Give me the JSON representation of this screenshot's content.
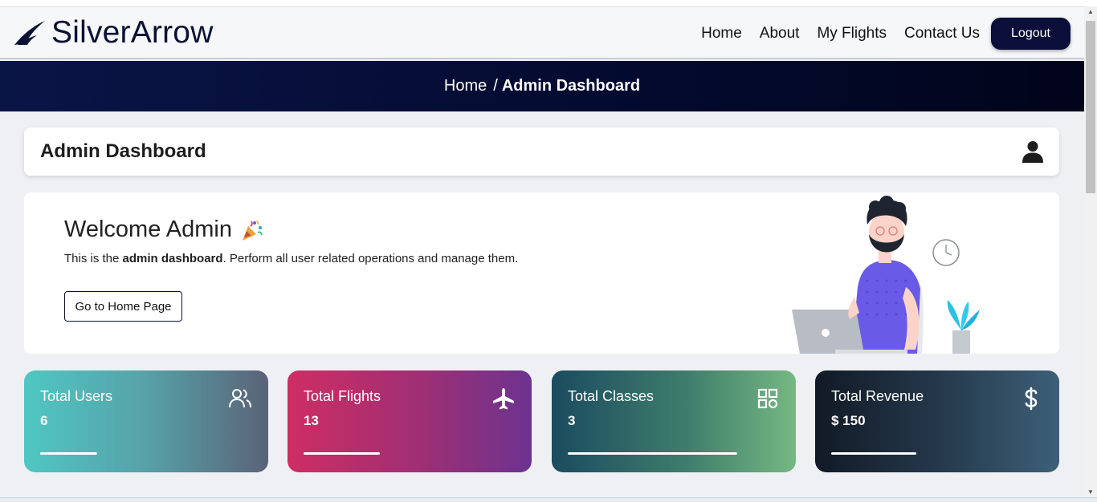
{
  "brand": {
    "name": "SilverArrow",
    "logo_icon": "arrow-wing-icon"
  },
  "nav": {
    "links": [
      "Home",
      "About",
      "My Flights",
      "Contact Us"
    ],
    "logout_label": "Logout"
  },
  "breadcrumb": {
    "home": "Home",
    "separator": "/",
    "current": "Admin Dashboard"
  },
  "header": {
    "title": "Admin Dashboard",
    "icon": "user-icon"
  },
  "welcome": {
    "title": "Welcome Admin",
    "emoji_icon": "party-popper-icon",
    "text_before": "This is the ",
    "text_bold": "admin dashboard",
    "text_after": ". Perform all user related operations and manage them.",
    "button_label": "Go to Home Page"
  },
  "stats": [
    {
      "label": "Total Users",
      "value": "6",
      "icon": "users-icon",
      "progress": 0.27
    },
    {
      "label": "Total Flights",
      "value": "13",
      "icon": "airplane-icon",
      "progress": 0.36
    },
    {
      "label": "Total Classes",
      "value": "3",
      "icon": "grid-icon",
      "progress": 0.8
    },
    {
      "label": "Total Revenue",
      "value": "$ 150",
      "icon": "dollar-icon",
      "progress": 0.4
    }
  ],
  "colors": {
    "navy": "#0b0f3a",
    "banner": "#030a2e",
    "page_bg": "#eef0f4"
  }
}
